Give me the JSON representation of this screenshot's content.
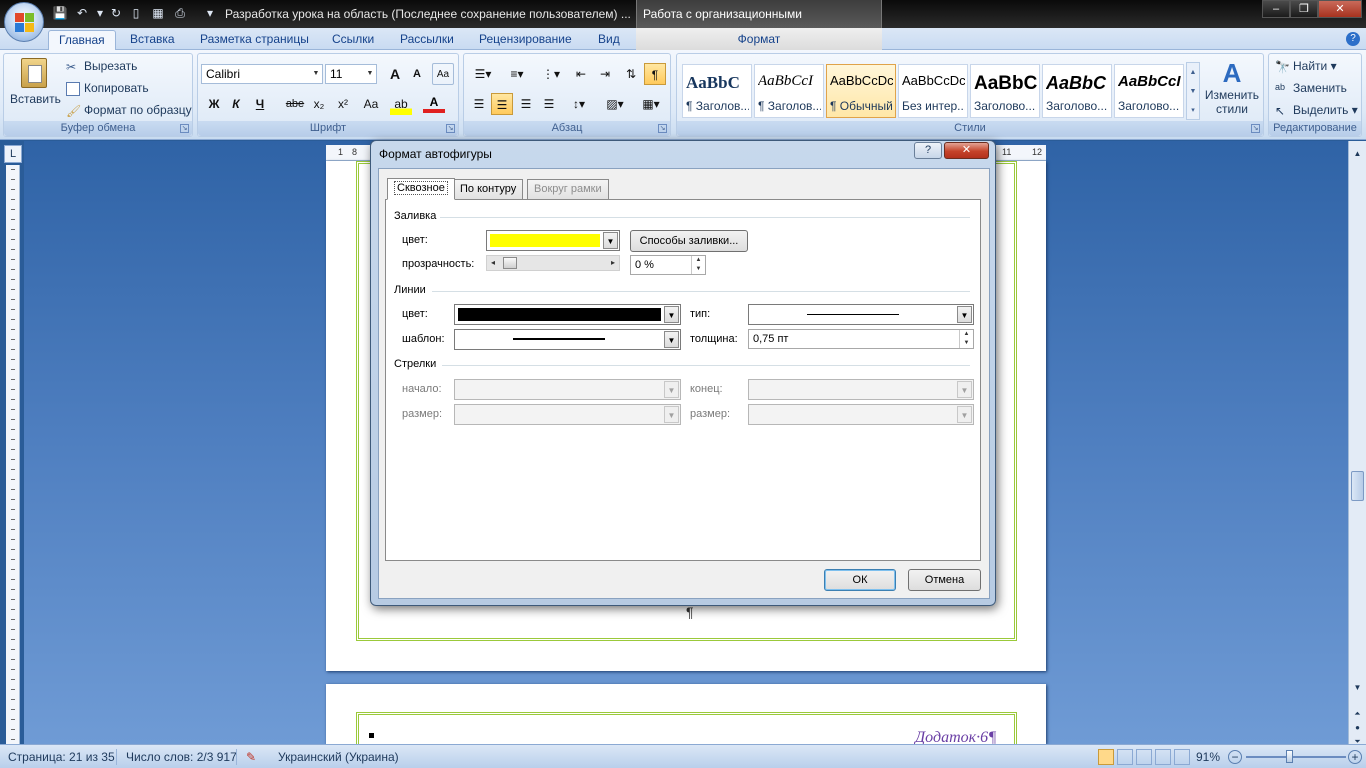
{
  "window": {
    "title": "Разработка урока на область (Последнее сохранение пользователем) ...",
    "contextual_group": "Работа с организационными диаграммами",
    "controls": {
      "minimize": "–",
      "maximize": "❐",
      "close": "✕"
    }
  },
  "ribbon": {
    "tabs": [
      "Главная",
      "Вставка",
      "Разметка страницы",
      "Ссылки",
      "Рассылки",
      "Рецензирование",
      "Вид"
    ],
    "active_tab": "Главная",
    "contextual_tab": "Формат",
    "clipboard": {
      "paste": "Вставить",
      "cut": "Вырезать",
      "copy": "Копировать",
      "format_painter": "Формат по образцу",
      "label": "Буфер обмена"
    },
    "font": {
      "name": "Calibri",
      "size": "11",
      "label": "Шрифт",
      "bold": "Ж",
      "italic": "К",
      "underline": "Ч",
      "strike": "abe",
      "subscript": "x₂",
      "superscript": "x²",
      "change_case": "Aa",
      "grow": "A",
      "shrink": "A",
      "font_color": "A"
    },
    "paragraph": {
      "label": "Абзац",
      "show_marks": "¶"
    },
    "styles": {
      "label": "Стили",
      "items": [
        {
          "sample": "AaBbC",
          "name": "¶ Заголов..."
        },
        {
          "sample": "AaBbCcI",
          "name": "¶ Заголов..."
        },
        {
          "sample": "AaBbCcDc",
          "name": "¶ Обычный"
        },
        {
          "sample": "AaBbCcDc",
          "name": "Без интер..."
        },
        {
          "sample": "AaBbC",
          "name": "Заголово..."
        },
        {
          "sample": "AaBbC",
          "name": "Заголово..."
        },
        {
          "sample": "AaBbCcI",
          "name": "Заголово..."
        }
      ],
      "change_styles_line1": "Изменить",
      "change_styles_line2": "стили"
    },
    "editing": {
      "label": "Редактирование",
      "find": "Найти",
      "replace": "Заменить",
      "select": "Выделить"
    }
  },
  "ruler": {
    "top_marks": [
      "1",
      "8",
      "11",
      "12"
    ],
    "corner": "L"
  },
  "document": {
    "paragraph_mark": "¶",
    "appendix_text": "Додаток·6¶"
  },
  "dialog": {
    "title": "Формат автофигуры",
    "help": "?",
    "close": "✕",
    "tabs": [
      {
        "label": "Сквозное",
        "state": "active"
      },
      {
        "label": "По контуру",
        "state": "normal"
      },
      {
        "label": "Вокруг рамки",
        "state": "disabled"
      }
    ],
    "fill": {
      "section": "Заливка",
      "color_label": "цвет:",
      "color_value": "#ffff00",
      "effects_button": "Способы заливки...",
      "transparency_label": "прозрачность:",
      "transparency_value": "0 %",
      "transparency_level": 0.04
    },
    "lines": {
      "section": "Линии",
      "color_label": "цвет:",
      "color_value": "#000000",
      "type_label": "тип:",
      "pattern_label": "шаблон:",
      "weight_label": "толщина:",
      "weight_value": "0,75 пт"
    },
    "arrows": {
      "section": "Стрелки",
      "begin_label": "начало:",
      "end_label": "конец:",
      "begin_size_label": "размер:",
      "end_size_label": "размер:"
    },
    "ok": "ОК",
    "cancel": "Отмена"
  },
  "statusbar": {
    "page": "Страница: 21 из 35",
    "words": "Число слов: 2/3 917",
    "language": "Украинский (Украина)",
    "zoom": "91%",
    "zoom_out": "−",
    "zoom_in": "+"
  }
}
